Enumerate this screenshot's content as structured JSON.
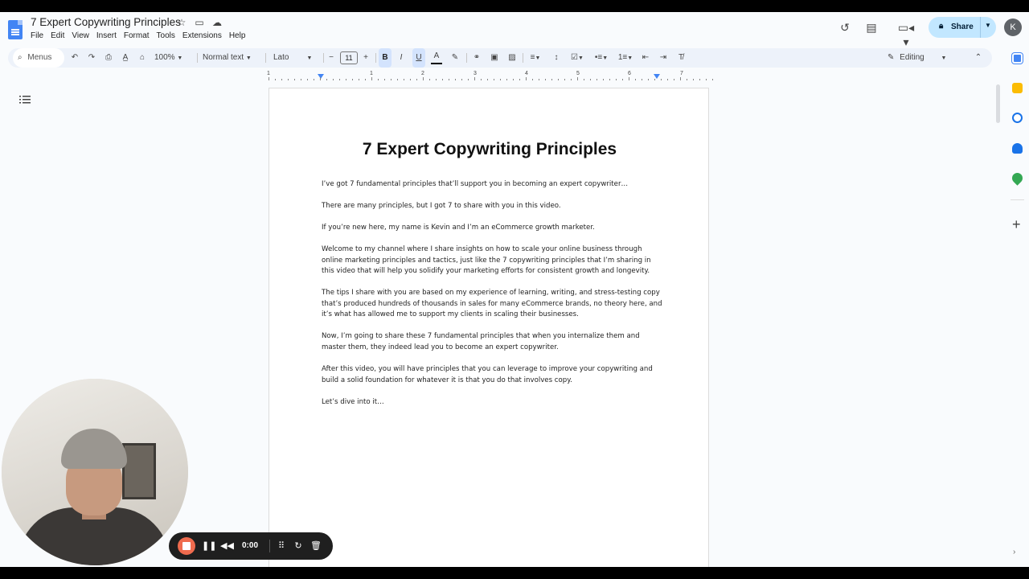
{
  "document": {
    "title": "7 Expert Copywriting Principles",
    "menu": [
      "File",
      "Edit",
      "View",
      "Insert",
      "Format",
      "Tools",
      "Extensions",
      "Help"
    ]
  },
  "header": {
    "share_label": "Share",
    "avatar_initial": "K"
  },
  "toolbar": {
    "menus_label": "Menus",
    "zoom": "100%",
    "style": "Normal text",
    "font": "Lato",
    "font_size": "11",
    "mode": "Editing"
  },
  "ruler": {
    "numbers": [
      "1",
      "1",
      "2",
      "3",
      "4",
      "5",
      "6",
      "7"
    ]
  },
  "page": {
    "heading": "7 Expert Copywriting Principles",
    "paragraphs": [
      "I’ve got 7 fundamental principles that’ll support you in becoming an expert copywriter…",
      "There are many principles, but I got 7 to share with you in this video.",
      "If you’re new here, my name is Kevin and I’m an eCommerce growth marketer.",
      "Welcome to my channel where I share insights on how to scale your online business through online marketing principles and tactics, just like the 7 copywriting principles that I’m sharing in this video that will help you solidify your marketing efforts for consistent growth and longevity.",
      "The tips I share with you are based on my experience of learning, writing, and stress-testing copy that’s produced hundreds of thousands in sales for many eCommerce brands, no theory here, and it’s what has allowed me to support my clients in scaling their businesses.",
      "Now, I’m going to share these 7 fundamental principles that when you internalize them and master them, they indeed lead you to become an expert copywriter.",
      "After this video, you will have principles that you can leverage to improve your copywriting and build a solid foundation for whatever it is that you do that involves copy.",
      "Let’s dive into it…"
    ]
  },
  "recorder": {
    "time": "0:00"
  },
  "colors": {
    "accent": "#4285f4",
    "share_bg": "#c2e7ff",
    "record": "#ef6b4e"
  }
}
